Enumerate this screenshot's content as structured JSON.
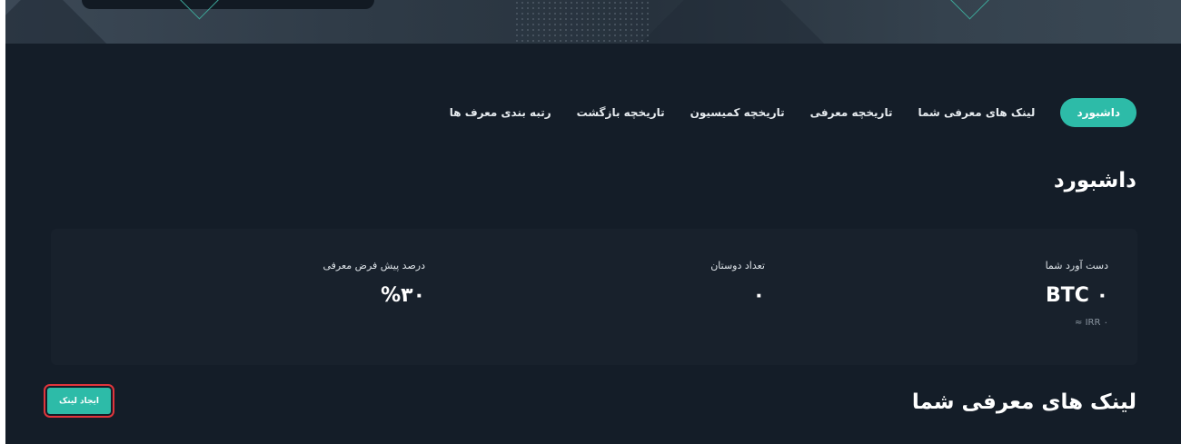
{
  "nav": {
    "tabs": [
      {
        "label": "داشبورد",
        "active": true
      },
      {
        "label": "لینک های معرفی شما"
      },
      {
        "label": "تاریخچه معرفی"
      },
      {
        "label": "تاریخچه کمیسیون"
      },
      {
        "label": "تاریخچه بازگشت"
      },
      {
        "label": "رتبه بندی معرف ها"
      }
    ]
  },
  "page_title": "داشبورد",
  "stats": {
    "earnings": {
      "label": "دست آورد شما",
      "value": "BTC ۰",
      "sub": "IRR ۰ ≈"
    },
    "friends": {
      "label": "تعداد دوستان",
      "value": "۰"
    },
    "default_percent": {
      "label": "درصد پیش فرض معرفی",
      "value": "%۳۰"
    }
  },
  "links_section": {
    "title": "لینک های معرفی شما",
    "create_button": "ایجاد لینک"
  },
  "colors": {
    "accent": "#2dbba8",
    "background": "#141d28",
    "card": "#18212c",
    "highlight_outline": "#e0353c"
  }
}
